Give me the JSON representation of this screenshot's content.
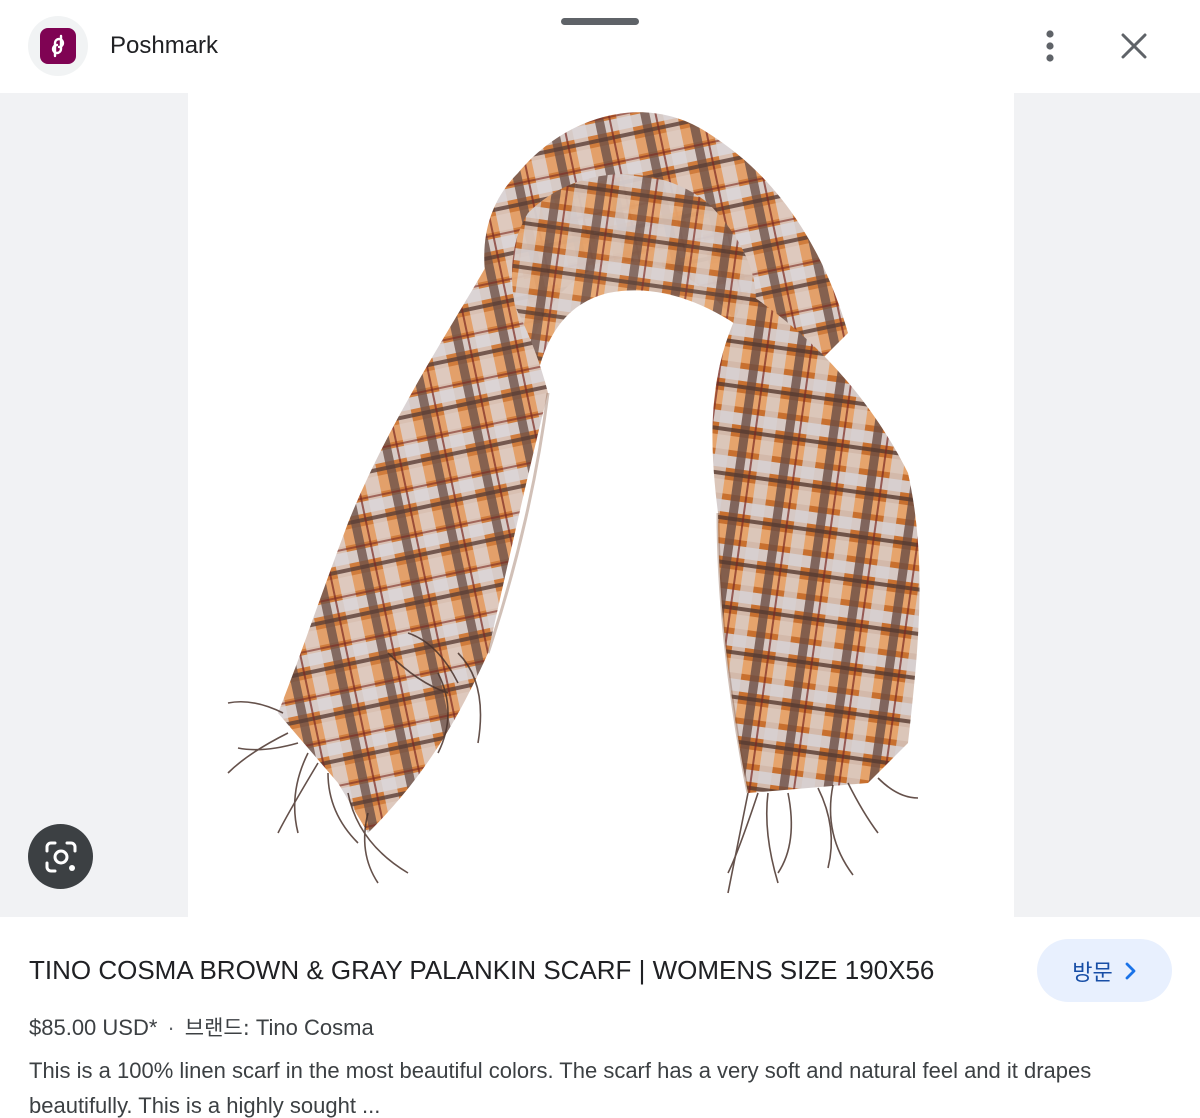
{
  "header": {
    "site_name": "Poshmark",
    "favicon_color": "#7f0353",
    "more_icon": "more-vert-icon",
    "close_icon": "close-icon"
  },
  "image": {
    "subject": "scarf",
    "palette": [
      "#c87536",
      "#e59a5a",
      "#d7d2d4",
      "#6d5049",
      "#7b2a22"
    ],
    "lens_icon": "lens-search-icon"
  },
  "product": {
    "title": "TINO COSMA BROWN & GRAY PALANKIN SCARF | WOMENS SIZE 190X56",
    "price": "$85.00 USD*",
    "separator": "·",
    "brand_label": "브랜드:",
    "brand_value": "Tino Cosma",
    "description": "This is a 100% linen scarf in the most beautiful colors. The scarf has a very soft and natural feel and it drapes beautifully. This is a highly sought ..."
  },
  "actions": {
    "visit_label": "방문"
  },
  "colors": {
    "accent": "#1a73e8",
    "visit_bg": "#e8f0fe",
    "side_bg": "#f1f2f4"
  }
}
